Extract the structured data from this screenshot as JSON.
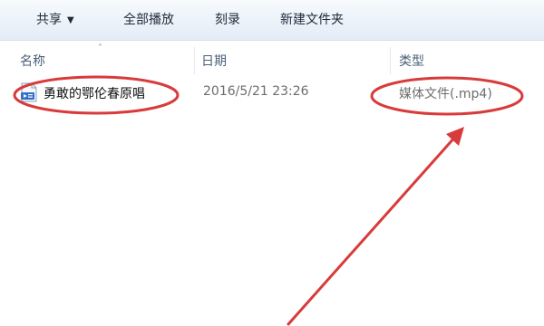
{
  "toolbar": {
    "share": "共享",
    "play_all": "全部播放",
    "burn": "刻录",
    "new_folder": "新建文件夹"
  },
  "columns": {
    "name": "名称",
    "date": "日期",
    "type": "类型"
  },
  "files": [
    {
      "name": "勇敢的鄂伦春原唱",
      "date": "2016/5/21 23:26",
      "type": "媒体文件(.mp4)"
    }
  ],
  "colors": {
    "annotation": "#d93a3a",
    "toolbar_bg": "#e8eff7",
    "header_text": "#4c607a"
  },
  "icons": {
    "share_caret": "chevron-down-icon",
    "sort": "sort-ascending-icon",
    "file": "media-file-icon"
  }
}
